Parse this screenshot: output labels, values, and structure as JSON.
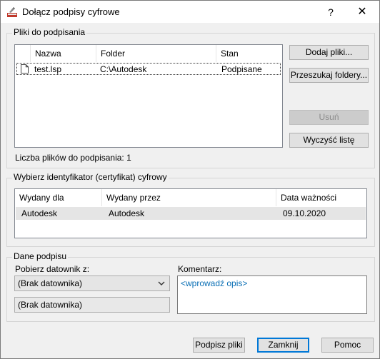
{
  "window": {
    "title": "Dołącz podpisy cyfrowe",
    "help_label": "?",
    "close_label": "✕"
  },
  "files_group": {
    "label": "Pliki do podpisania",
    "columns": [
      "Nazwa",
      "Folder",
      "Stan"
    ],
    "rows": [
      {
        "name": "test.lsp",
        "folder": "C:\\Autodesk",
        "status": "Podpisane"
      }
    ],
    "count_label": "Liczba plików do podpisania: 1",
    "buttons": {
      "add_files": "Dodaj pliki...",
      "search_folders": "Przeszukaj foldery...",
      "remove": "Usuń",
      "clear_list": "Wyczyść listę"
    }
  },
  "cert_group": {
    "label": "Wybierz identyfikator (certyfikat) cyfrowy",
    "columns": [
      "Wydany dla",
      "Wydany przez",
      "Data ważności"
    ],
    "rows": [
      {
        "issued_to": "Autodesk",
        "issued_by": "Autodesk",
        "expiry": "09.10.2020"
      }
    ]
  },
  "signature_group": {
    "label": "Dane podpisu",
    "timestamp_label": "Pobierz datownik z:",
    "timestamp_selected": "(Brak datownika)",
    "timestamp_display": "(Brak datownika)",
    "comment_label": "Komentarz:",
    "comment_placeholder": "<wprowadź opis>"
  },
  "footer": {
    "sign_files": "Podpisz pliki",
    "close": "Zamknij",
    "help": "Pomoc"
  },
  "icons": {
    "app": "signature-app-icon",
    "file": "file-icon",
    "dropdown": "chevron-down-icon"
  }
}
